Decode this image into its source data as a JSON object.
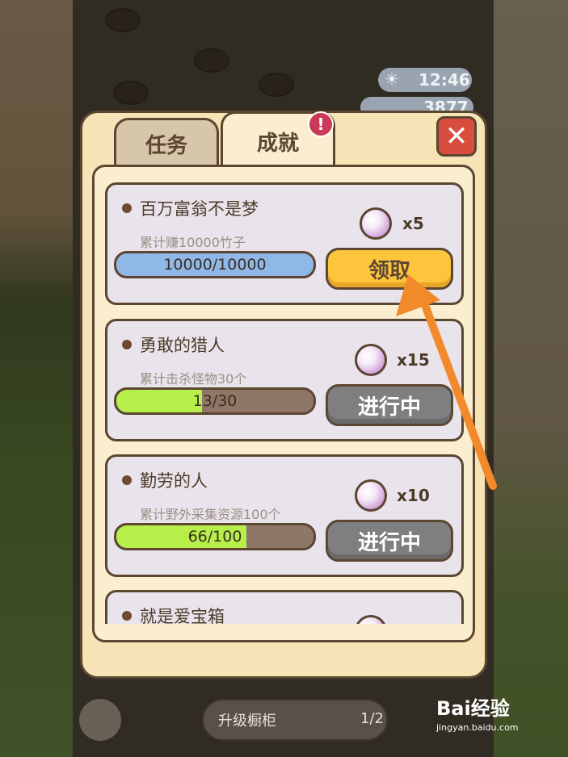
{
  "hud": {
    "time": "12:46",
    "coins": "3877"
  },
  "tabs": [
    {
      "label": "任务",
      "active": false
    },
    {
      "label": "成就",
      "active": true,
      "badge": "!"
    }
  ],
  "close_label": "✕",
  "achievements": [
    {
      "title": "百万富翁不是梦",
      "desc": "累计赚10000竹子",
      "progress_text": "10000/10000",
      "progress": 1.0,
      "reward": "x5",
      "button": "领取",
      "state": "claim",
      "bar_color": "#8fb7e8"
    },
    {
      "title": "勇敢的猎人",
      "desc": "累计击杀怪物30个",
      "progress_text": "13/30",
      "progress": 0.433,
      "reward": "x15",
      "button": "进行中",
      "state": "progress",
      "bar_color": "#b7ef4b"
    },
    {
      "title": "勤劳的人",
      "desc": "累计野外采集资源100个",
      "progress_text": "66/100",
      "progress": 0.66,
      "reward": "x10",
      "button": "进行中",
      "state": "progress",
      "bar_color": "#b7ef4b"
    },
    {
      "title": "就是爱宝箱",
      "desc": "",
      "progress_text": "",
      "progress": 0,
      "reward": "",
      "button": "",
      "state": "progress",
      "bar_color": "#b7ef4b"
    }
  ],
  "footer": {
    "upgrade_label": "升级橱柜",
    "count": "1/2"
  },
  "watermark": {
    "brand": "Bai经验",
    "url": "jingyan.baidu.com"
  },
  "colors": {
    "arrow": "#f28a2c",
    "panel": "#f6e3b6",
    "border": "#5b4632"
  }
}
